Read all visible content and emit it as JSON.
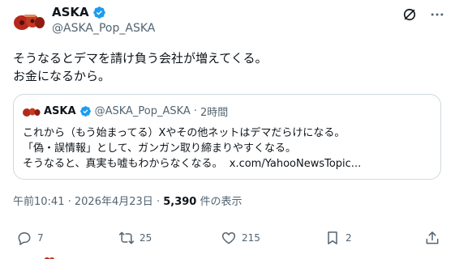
{
  "author": {
    "name": "ASKA",
    "handle": "@ASKA_Pop_ASKA"
  },
  "tweet": {
    "lines": [
      "そうなるとデマを請け負う会社が増えてくる。",
      "お金になるから。"
    ]
  },
  "quote": {
    "name": "ASKA",
    "handle": "@ASKA_Pop_ASKA",
    "dot": "·",
    "time": "2時間",
    "lines": [
      "これから（もう始まってる）Xやその他ネットはデマだらけになる。",
      "「偽・誤情報」として、ガンガン取り締まりやすくなる。",
      "そうなると、真実も嘘もわからなくなる。"
    ],
    "link": "x.com/YahooNewsTopic..."
  },
  "meta": {
    "time": "午前10:41",
    "sep": "·",
    "date": "2026年4月23日",
    "sep2": "·",
    "views": "5,390",
    "views_label": "件の表示"
  },
  "actions": {
    "replies": "7",
    "reposts": "25",
    "likes": "215",
    "bookmarks": "2"
  },
  "colors": {
    "verified": "#1d9bf0",
    "secondary_text": "#536471",
    "border": "#cfd9de",
    "avatar": "#b5291d"
  },
  "icons": [
    "verified-icon",
    "grok-icon",
    "more-icon",
    "reply-icon",
    "repost-icon",
    "like-icon",
    "bookmark-icon",
    "share-icon"
  ]
}
